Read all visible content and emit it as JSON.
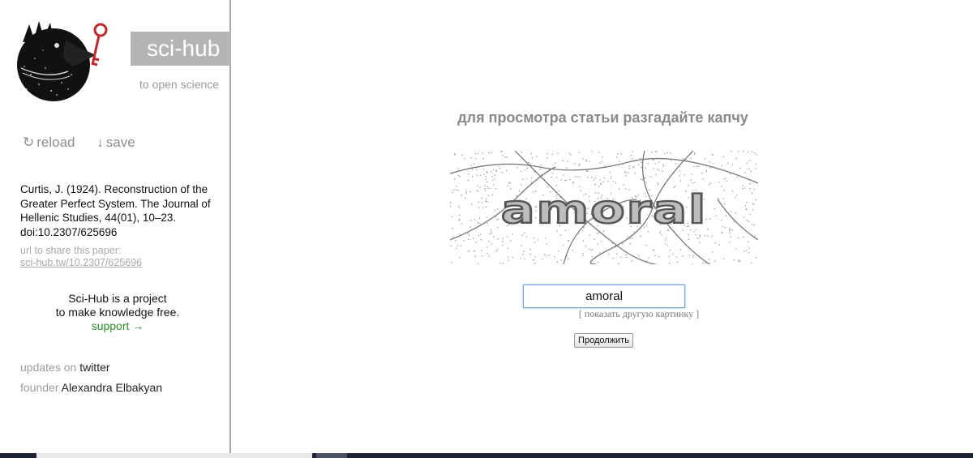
{
  "brand": {
    "name": "sci-hub",
    "tagline": "to open science"
  },
  "actions": {
    "reload_glyph": "↻",
    "reload_label": "reload",
    "save_glyph": "↓",
    "save_label": "save"
  },
  "citation": {
    "text": "Curtis, J. (1924). Reconstruction of the Greater Perfect System. The Journal of Hellenic Studies, 44(01), 10–23. doi:10.2307/625696",
    "share_label": "url to share this paper:",
    "share_url": "sci-hub.tw/10.2307/625696"
  },
  "project": {
    "line1": "Sci-Hub is a project",
    "line2": "to make knowledge free.",
    "support_label": "support →"
  },
  "updates": {
    "prefix": "updates on",
    "link": "twitter"
  },
  "founder": {
    "prefix": "founder",
    "name": "Alexandra Elbakyan"
  },
  "captcha": {
    "prompt": "для просмотра статьи разгадайте капчу",
    "image_text": "amoral",
    "input_value": "amoral",
    "other_picture_label": "[ показать другую картинку ]",
    "continue_label": "Продолжить"
  },
  "colors": {
    "brand_box": "#b4b4b4",
    "support_link": "#2e8b2e",
    "key_red": "#c0282d",
    "input_border": "#7aa7d9"
  },
  "icons": {
    "logo": "raven-with-key-icon",
    "reload": "reload-icon",
    "save": "download-arrow-icon"
  }
}
